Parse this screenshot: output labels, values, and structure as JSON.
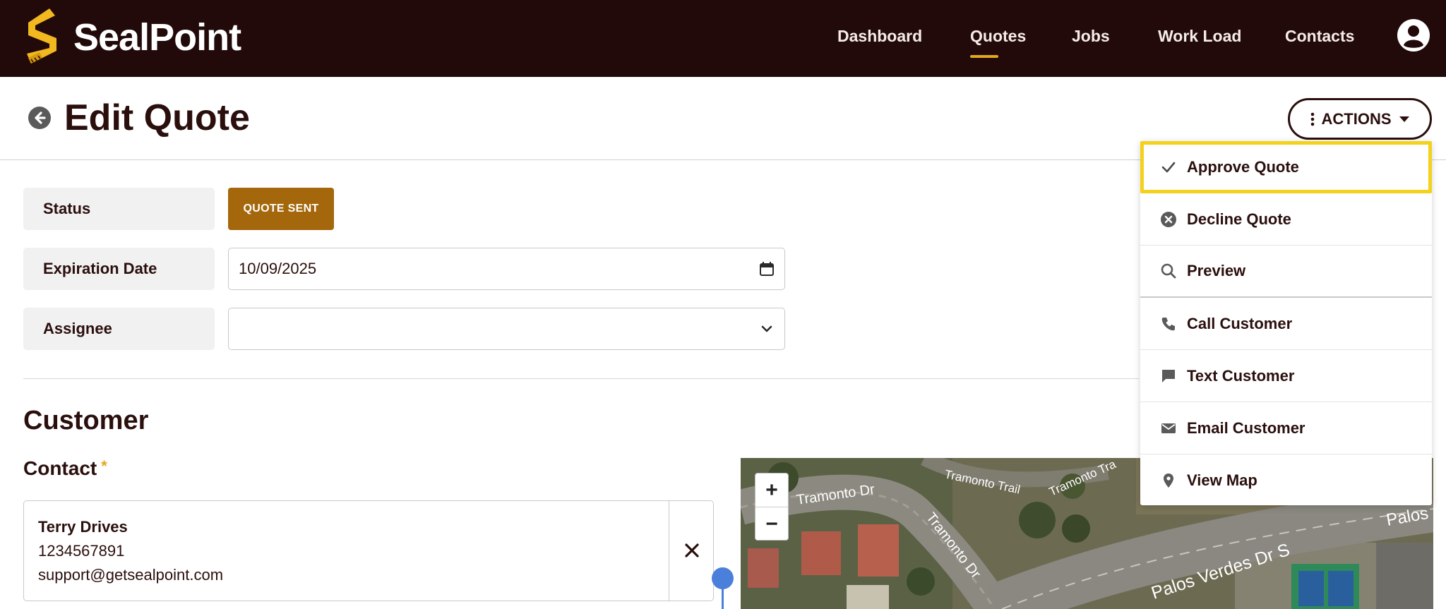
{
  "app": {
    "brand": "SealPoint"
  },
  "nav": {
    "items": [
      {
        "label": "Dashboard"
      },
      {
        "label": "Quotes",
        "active": true
      },
      {
        "label": "Jobs"
      },
      {
        "label": "Work Load"
      },
      {
        "label": "Contacts"
      }
    ]
  },
  "header": {
    "title": "Edit Quote",
    "actions_label": "ACTIONS"
  },
  "form": {
    "status": {
      "label": "Status",
      "value": "QUOTE SENT"
    },
    "expiration": {
      "label": "Expiration Date",
      "value": "10/09/2025"
    },
    "assignee": {
      "label": "Assignee",
      "value": ""
    }
  },
  "customer": {
    "section_title": "Customer",
    "contact_label": "Contact",
    "required_mark": "*",
    "contact": {
      "name": "Terry Drives",
      "phone": "1234567891",
      "email": "support@getsealpoint.com"
    }
  },
  "map": {
    "zoom_in": "+",
    "zoom_out": "−",
    "labels": [
      "Tramonto Dr",
      "Tramonto Dr",
      "Tramonto Trail",
      "Tramonto Tra",
      "Palos Verdes Dr S",
      "Palos"
    ]
  },
  "actions_menu": {
    "items": [
      {
        "label": "Approve Quote",
        "icon": "check-icon",
        "highlighted": true
      },
      {
        "label": "Decline Quote",
        "icon": "circle-x-icon"
      },
      {
        "label": "Preview",
        "icon": "search-icon"
      },
      {
        "label": "Call Customer",
        "icon": "phone-icon"
      },
      {
        "label": "Text Customer",
        "icon": "chat-icon"
      },
      {
        "label": "Email Customer",
        "icon": "envelope-icon"
      },
      {
        "label": "View Map",
        "icon": "map-pin-icon"
      }
    ]
  },
  "colors": {
    "topbar": "#230a0a",
    "accent": "#e0a820",
    "status_badge": "#a4670c",
    "highlight": "#f4d21c",
    "pin": "#4a7fdc"
  }
}
